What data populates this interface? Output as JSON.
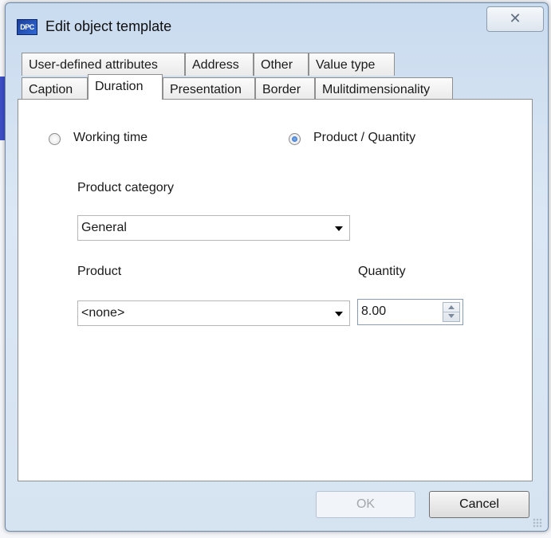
{
  "window": {
    "title": "Edit object template",
    "app_icon": "app-logo-icon",
    "app_icon_text": "DPC",
    "close_glyph": "✕"
  },
  "tabs": {
    "row_top": [
      "User-defined attributes",
      "Address",
      "Other",
      "Value type"
    ],
    "row_bottom": [
      "Caption",
      "Duration",
      "Presentation",
      "Border",
      "Mulitdimensionality"
    ],
    "active": "Duration"
  },
  "duration": {
    "mode_working_time_label": "Working time",
    "mode_product_label": "Product / Quantity",
    "selected_mode": "Product / Quantity",
    "product_category_label": "Product category",
    "product_category_value": "General",
    "product_label": "Product",
    "product_value": "<none>",
    "quantity_label": "Quantity",
    "quantity_value": "8.00"
  },
  "footer": {
    "ok_label": "OK",
    "ok_enabled": false,
    "cancel_label": "Cancel"
  },
  "colors": {
    "title_bar": "#c9dbef",
    "accent_radio": "#1f62c4"
  }
}
